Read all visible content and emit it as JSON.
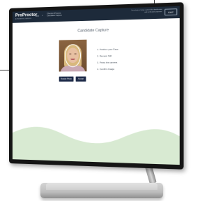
{
  "header": {
    "logo": "ProProctor",
    "logo_sub": "A PROMETRIC SERVICE",
    "nav_label": "Exit",
    "nav_title_line1": "Check-in Process",
    "nav_title_line2": "Candidate Capture",
    "status_line1": "Your photo is being captured for identification",
    "status_line2": "and verification purposes.",
    "exit_label": "EXIT"
  },
  "main": {
    "title": "Candidate Capture",
    "steps": [
      "1. Position your Face",
      "2. Remain Still",
      "3. Press the camera",
      "4. Confirm Image"
    ],
    "retake_label": "Retake Photo",
    "accept_label": "Accept"
  },
  "colors": {
    "header_bg": "#1d2a3a",
    "button_bg": "#1d2a48",
    "wave_fill": "#d8ead2"
  }
}
